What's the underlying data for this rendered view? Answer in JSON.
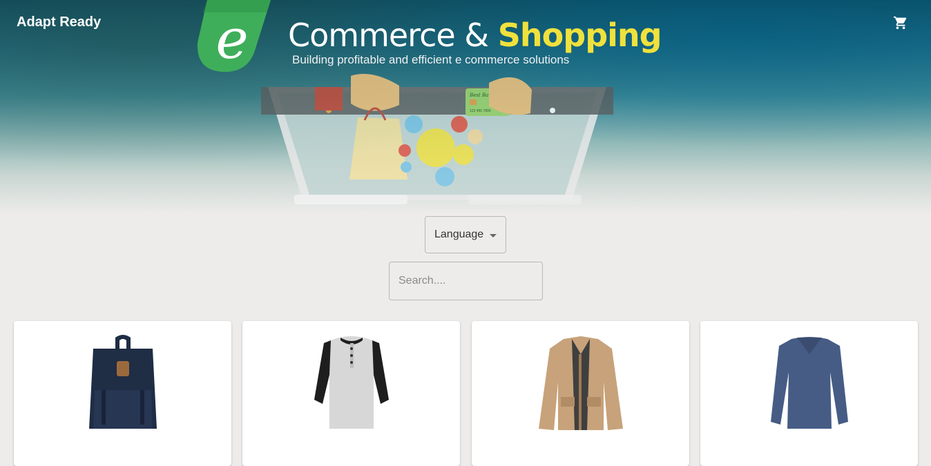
{
  "header": {
    "brand": "Adapt Ready",
    "cart_icon": "cart-icon",
    "title_part1": "Commerce &",
    "title_part2": "Shopping",
    "subtitle": "Building profitable and efficient e commerce solutions",
    "logo_letter": "e",
    "card_bank_label": "Best Bank",
    "card_number": "123 456 7890"
  },
  "filters": {
    "language_label": "Language",
    "search_placeholder": "Search...."
  },
  "products": [
    {
      "name": "backpack",
      "color": "#1f2d45"
    },
    {
      "name": "henley-shirt",
      "color": "#d7d7d7"
    },
    {
      "name": "jacket",
      "color": "#c7a27a"
    },
    {
      "name": "long-sleeve-shirt",
      "color": "#465c85"
    }
  ],
  "colors": {
    "accent": "#f0e13c",
    "logo_green": "#3fae5a"
  }
}
